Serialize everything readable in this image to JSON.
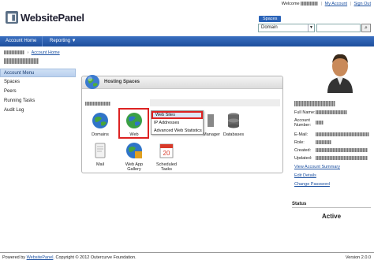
{
  "header": {
    "logo_text": "WebsitePanel",
    "welcome_text": "Welcome",
    "my_account": "My Account",
    "sign_out": "Sign Out",
    "spaces_label": "Spaces",
    "search_select": "Domain"
  },
  "nav": {
    "account_home": "Account Home",
    "reporting": "Reporting ▼"
  },
  "breadcrumb": {
    "current": "Account Home"
  },
  "account_menu": {
    "title": "Account Menu",
    "items": [
      "Spaces",
      "Peers",
      "Running Tasks",
      "Audit Log"
    ]
  },
  "hosting": {
    "title": "Hosting Spaces",
    "icons": [
      "Domains",
      "Web",
      "Manager",
      "Databases",
      "Mail",
      "Web App Gallery",
      "Scheduled Tasks"
    ],
    "popup": [
      "Web Sites",
      "IP Addresses",
      "Advanced Web Statistics"
    ]
  },
  "profile": {
    "full_name_label": "Full Name:",
    "account_number_label": "Account Number:",
    "email_label": "E-Mail:",
    "role_label": "Role:",
    "created_label": "Created:",
    "updated_label": "Updated:",
    "view_summary": "View Account Summary",
    "edit_details": "Edit Details",
    "change_password": "Change Password"
  },
  "status": {
    "label": "Status",
    "value": "Active"
  },
  "footer": {
    "powered_by": "Powered by",
    "link": "WebsitePanel",
    "copyright": ". Copyright © 2012 Outercurve Foundation.",
    "version": "Version 2.0.0"
  },
  "colors": {
    "nav_blue": "#2a5eb0",
    "highlight_red": "#d22222"
  }
}
